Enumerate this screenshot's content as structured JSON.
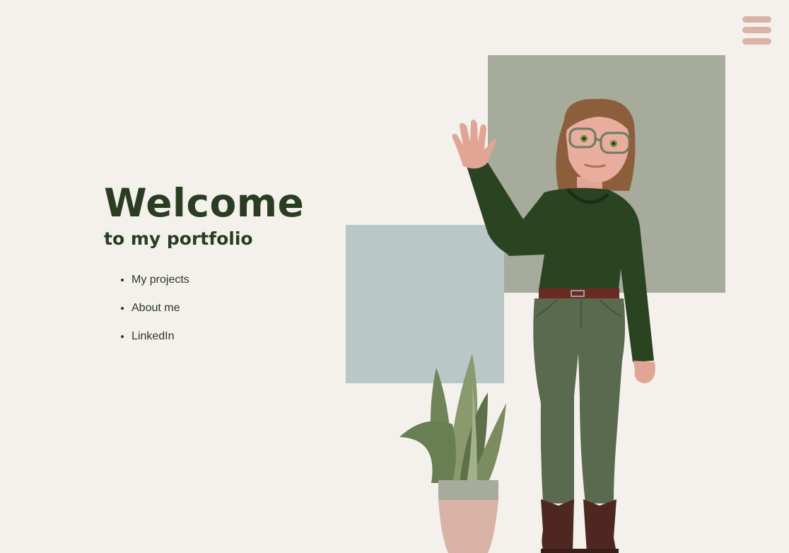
{
  "header": {
    "menu_icon": "hamburger-menu-icon"
  },
  "hero": {
    "title": "Welcome",
    "subtitle": "to my portfolio"
  },
  "nav": {
    "items": [
      {
        "label": "My projects"
      },
      {
        "label": "About me"
      },
      {
        "label": "LinkedIn"
      }
    ]
  },
  "colors": {
    "background": "#f4f1ed",
    "text_dark_green": "#2a3d22",
    "menu_pink": "#d9b3a6",
    "block_sage": "#a6ab9b",
    "block_blue_grey": "#b9c7c7",
    "sweater_green": "#2a4321",
    "pants_green": "#5a6a4e"
  },
  "illustration": {
    "subject": "waving-woman-illustration",
    "plant": "snake-plant-illustration"
  }
}
